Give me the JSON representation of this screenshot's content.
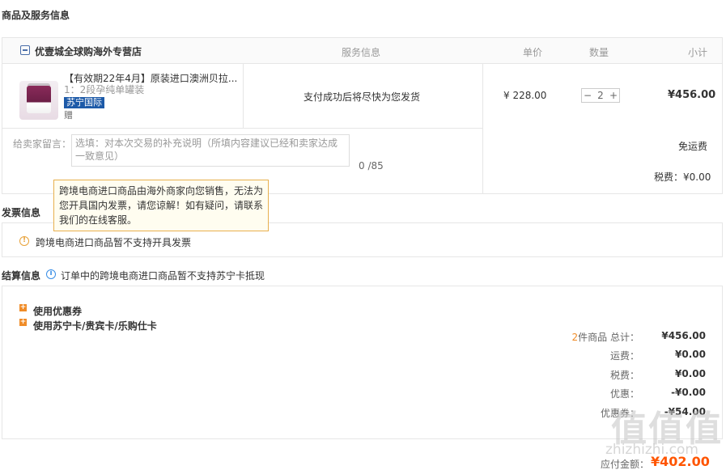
{
  "goods_section": {
    "title": "商品及服务信息",
    "shop_name": "优壹城全球购海外专营店",
    "columns": {
      "service": "服务信息",
      "unit_price": "单价",
      "quantity": "数量",
      "subtotal": "小计"
    },
    "product": {
      "name": "【有效期22年4月】原装进口澳洲贝拉...",
      "spec": "1：2段孕纯单罐装",
      "tag": "苏宁国际",
      "badge": "赠",
      "service_info": "支付成功后将尽快为您发货",
      "unit_price": "¥ 228.00",
      "quantity": "2",
      "minus": "−",
      "plus": "+",
      "subtotal": "¥456.00"
    },
    "message": {
      "label": "给卖家留言：",
      "placeholder": "选填：对本次交易的补充说明（所填内容建议已经和卖家达成一致意见）",
      "counter": "0 /85"
    },
    "shipping": "免运费",
    "tax": "税费：¥0.00",
    "tooltip": "跨境电商进口商品由海外商家向您销售，无法为您开具国内发票，请您谅解！如有疑问，请联系我们的在线客服。"
  },
  "invoice_section": {
    "title": "发票信息",
    "notice": "跨境电商进口商品暂不支持开具发票"
  },
  "settlement_section": {
    "title": "结算信息",
    "notice": "订单中的跨境电商进口商品暂不支持苏宁卡抵现",
    "options": [
      {
        "label": "使用优惠券"
      },
      {
        "label": "使用苏宁卡/贵宾卡/乐购仕卡"
      }
    ],
    "summary": {
      "count": "2",
      "count_suffix": "件商品 总计：",
      "total": "¥456.00",
      "shipping_label": "运费：",
      "shipping": "¥0.00",
      "tax_label": "税费：",
      "tax": "¥0.00",
      "discount_label": "优惠：",
      "discount": "-¥0.00",
      "coupon_label": "优惠券：",
      "coupon": "-¥54.00"
    },
    "due_label": "应付金额：",
    "due": "¥402.00"
  },
  "watermark": {
    "logo": "值值值",
    "site": "zhizhizhi.com"
  },
  "colors": {
    "accent_orange": "#f08c28",
    "price_red": "#ff5500",
    "suning_blue": "#1d5aa8",
    "tooltip_border": "#e8b04e"
  }
}
